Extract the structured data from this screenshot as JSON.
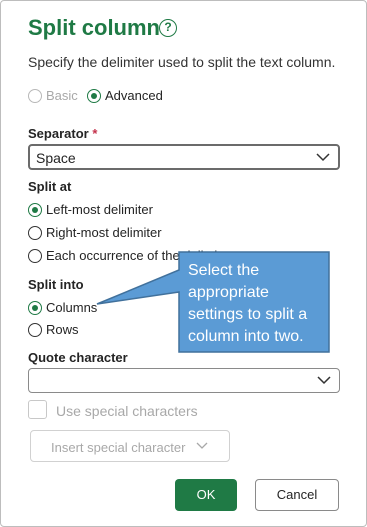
{
  "dialog": {
    "title": "Split column",
    "description": "Specify the delimiter used to split the text column."
  },
  "mode": {
    "basic_label": "Basic",
    "advanced_label": "Advanced",
    "selected": "Advanced"
  },
  "separator": {
    "label": "Separator",
    "required_mark": "*",
    "value": "Space"
  },
  "split_at": {
    "label": "Split at",
    "options": [
      "Left-most delimiter",
      "Right-most delimiter",
      "Each occurrence of the delimiter"
    ],
    "selected": "Left-most delimiter"
  },
  "split_into": {
    "label": "Split into",
    "options": [
      "Columns",
      "Rows"
    ],
    "selected": "Columns"
  },
  "quote": {
    "label": "Quote character",
    "value": ""
  },
  "special": {
    "checkbox_label": "Use special characters",
    "insert_label": "Insert special character"
  },
  "buttons": {
    "ok": "OK",
    "cancel": "Cancel"
  },
  "callout": {
    "text": "Select the appropriate settings to split a column into two.",
    "fill_color": "#5b9bd5",
    "border_color": "#41719c"
  },
  "colors": {
    "accent": "#1f7a45"
  }
}
